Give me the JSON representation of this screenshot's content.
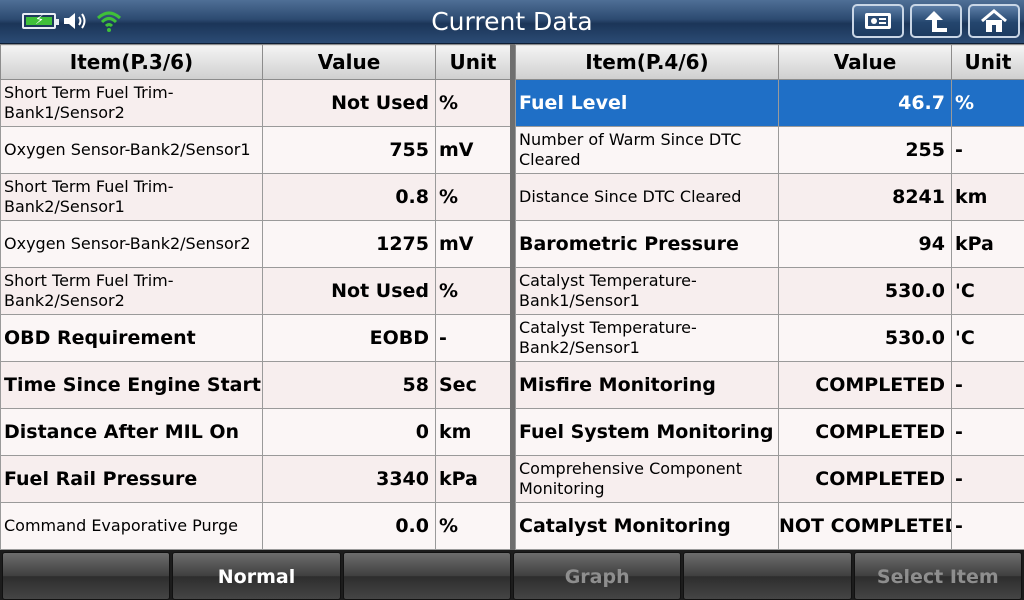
{
  "title": "Current Data",
  "left_table": {
    "headers": {
      "item": "Item(P.3/6)",
      "value": "Value",
      "unit": "Unit"
    },
    "rows": [
      {
        "item": "Short Term Fuel Trim-Bank1/Sensor2",
        "value": "Not Used",
        "unit": "%"
      },
      {
        "item": "Oxygen Sensor-Bank2/Sensor1",
        "value": "755",
        "unit": "mV"
      },
      {
        "item": "Short Term Fuel Trim-Bank2/Sensor1",
        "value": "0.8",
        "unit": "%"
      },
      {
        "item": "Oxygen Sensor-Bank2/Sensor2",
        "value": "1275",
        "unit": "mV"
      },
      {
        "item": "Short Term Fuel Trim-Bank2/Sensor2",
        "value": "Not Used",
        "unit": "%"
      },
      {
        "item": "OBD Requirement",
        "value": "EOBD",
        "unit": "-"
      },
      {
        "item": "Time Since Engine Start",
        "value": "58",
        "unit": "Sec"
      },
      {
        "item": "Distance After MIL On",
        "value": "0",
        "unit": "km"
      },
      {
        "item": "Fuel Rail Pressure",
        "value": "3340",
        "unit": "kPa"
      },
      {
        "item": "Command Evaporative Purge",
        "value": "0.0",
        "unit": "%"
      }
    ]
  },
  "right_table": {
    "headers": {
      "item": "Item(P.4/6)",
      "value": "Value",
      "unit": "Unit"
    },
    "rows": [
      {
        "item": "Fuel Level",
        "value": "46.7",
        "unit": "%"
      },
      {
        "item": "Number of Warm Since DTC Cleared",
        "value": "255",
        "unit": "-"
      },
      {
        "item": "Distance Since DTC Cleared",
        "value": "8241",
        "unit": "km"
      },
      {
        "item": "Barometric Pressure",
        "value": "94",
        "unit": "kPa"
      },
      {
        "item": "Catalyst Temperature-Bank1/Sensor1",
        "value": "530.0",
        "unit": "'C"
      },
      {
        "item": "Catalyst Temperature-Bank2/Sensor1",
        "value": "530.0",
        "unit": "'C"
      },
      {
        "item": "Misfire Monitoring",
        "value": "COMPLETED",
        "unit": "-"
      },
      {
        "item": "Fuel System Monitoring",
        "value": "COMPLETED",
        "unit": "-"
      },
      {
        "item": "Comprehensive Component Monitoring",
        "value": "COMPLETED",
        "unit": "-"
      },
      {
        "item": "Catalyst Monitoring",
        "value": "NOT COMPLETED",
        "unit": "-"
      }
    ]
  },
  "toolbar": {
    "btn1": "",
    "btn2": "Normal",
    "btn3": "",
    "btn4": "Graph",
    "btn5": "",
    "btn6": "Select Item"
  },
  "icons": {
    "battery": "battery-charging-icon",
    "speaker": "speaker-icon",
    "wifi": "wifi-icon",
    "nav1": "vehicle-info-icon",
    "nav2": "back-arrow-icon",
    "nav3": "home-icon"
  },
  "colors": {
    "selected_row": "#1f6fc6",
    "battery_fill": "#3fc03a",
    "wifi": "#3fc03a"
  }
}
